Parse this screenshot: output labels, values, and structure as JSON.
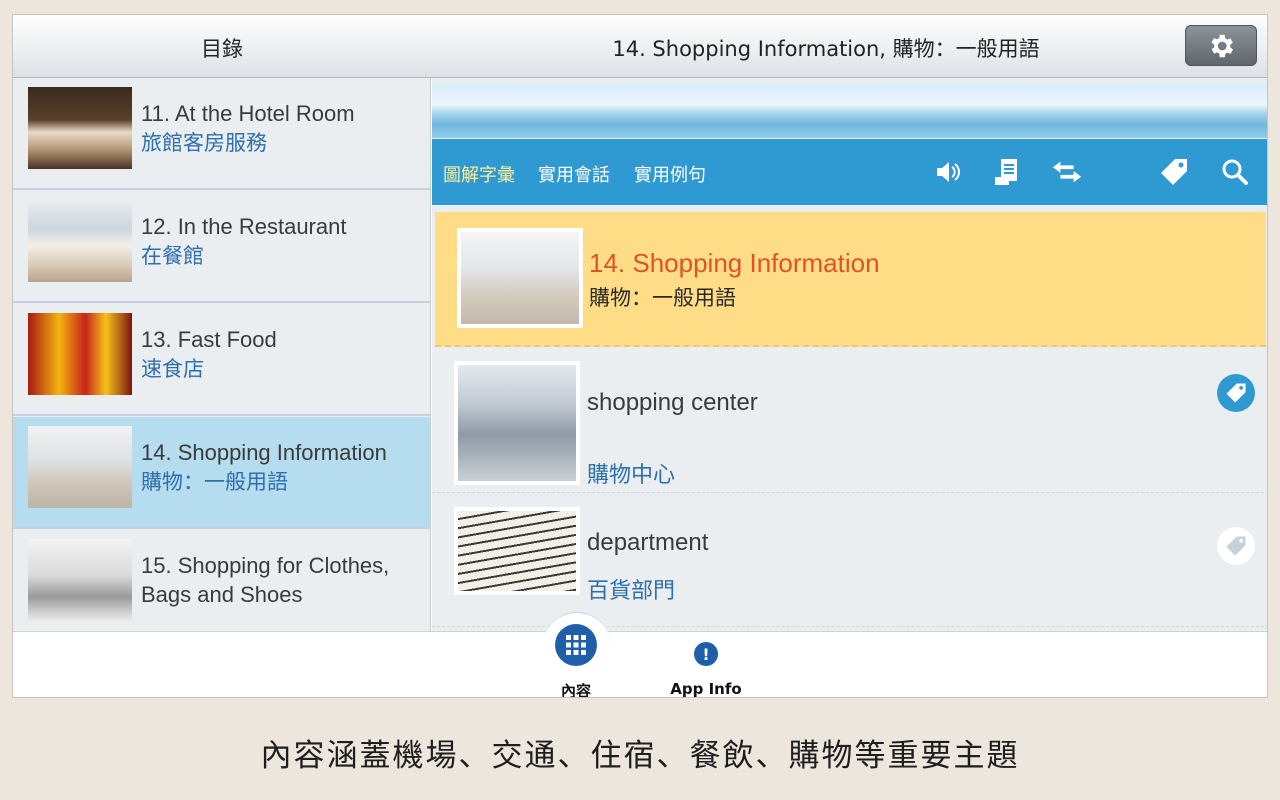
{
  "topbar": {
    "left_title": "目錄",
    "main_title": "14. Shopping Information, 購物：一般用語",
    "settings_icon": "gear-icon"
  },
  "sidebar": {
    "items": [
      {
        "en": "11. At the Hotel Room",
        "zh": "旅館客房服務",
        "thumb": "hotel-room-photo"
      },
      {
        "en": "12. In the Restaurant",
        "zh": "在餐館",
        "thumb": "restaurant-photo"
      },
      {
        "en": "13. Fast Food",
        "zh": "速食店",
        "thumb": "fast-food-photo"
      },
      {
        "en": "14. Shopping Information",
        "zh": "購物：一般用語",
        "thumb": "shopping-family-photo",
        "active": true
      },
      {
        "en": "15. Shopping for Clothes,",
        "en2": "Bags and Shoes",
        "thumb": "clothes-store-photo"
      }
    ]
  },
  "toolbar": {
    "tabs": [
      "圖解字彙",
      "實用會話",
      "實用例句"
    ],
    "active_tab": "圖解字彙",
    "icons": [
      "speaker-icon",
      "document-icon",
      "swap-icon",
      "tag-icon",
      "search-icon"
    ]
  },
  "lesson": {
    "title_en": "14. Shopping Information",
    "title_zh": "購物：一般用語"
  },
  "vocab": [
    {
      "en": "shopping center",
      "zh": "購物中心",
      "tagged": true
    },
    {
      "en": "department",
      "zh": "百貨部門",
      "tagged": false
    }
  ],
  "bottom_nav": {
    "contents_label": "內容",
    "info_label": "App Info"
  },
  "caption": "內容涵蓋機場、交通、住宿、餐飲、購物等重要主題",
  "colors": {
    "toolbar_blue": "#2f99d1",
    "active_row": "#b6dcef",
    "header_card": "#ffdd86",
    "title_orange": "#e0522a",
    "zh_blue": "#2c6fad",
    "nav_blue": "#1f5ea8"
  }
}
